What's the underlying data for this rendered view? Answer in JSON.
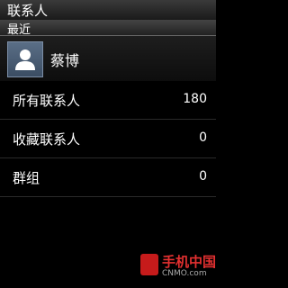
{
  "title": "联系人",
  "recent": {
    "header": "最近",
    "contact_name": "蔡博"
  },
  "list": [
    {
      "label": "所有联系人",
      "count": "180"
    },
    {
      "label": "收藏联系人",
      "count": "0"
    },
    {
      "label": "群组",
      "count": "0"
    }
  ],
  "watermark": {
    "brand": "手机中国",
    "sub": "CNMO.com"
  }
}
